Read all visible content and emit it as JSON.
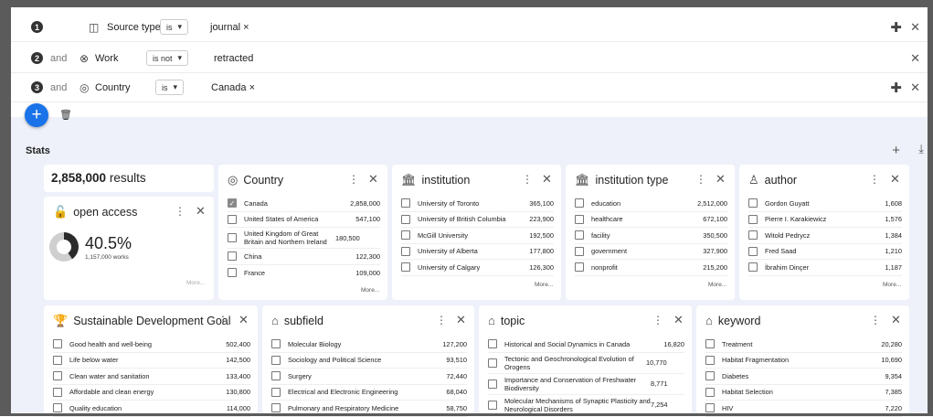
{
  "filters": [
    {
      "num": "1",
      "and": "",
      "icon": "◫",
      "label": "Source type",
      "op": "is",
      "value": "journal ×",
      "plus": true
    },
    {
      "num": "2",
      "and": "and",
      "icon": "⊗",
      "label": "Work",
      "op": "is not",
      "value": "retracted",
      "plus": false
    },
    {
      "num": "3",
      "and": "and",
      "icon": "◎",
      "label": "Country",
      "op": "is",
      "value": "Canada ×",
      "plus": true
    }
  ],
  "stats": {
    "title": "Stats",
    "results_count": "2,858,000",
    "results_label": "results"
  },
  "open_access": {
    "title": "open access",
    "percent": "40.5%",
    "percent_value": 40.5,
    "works": "1,157,000 works",
    "more": "More..."
  },
  "cards": {
    "country": {
      "title": "Country",
      "more": "More...",
      "rows": [
        {
          "label": "Canada",
          "count": "2,858,000",
          "checked": true
        },
        {
          "label": "United States of America",
          "count": "547,100",
          "checked": false
        },
        {
          "label": "United Kingdom of Great Britain and Northern Ireland",
          "count": "180,500",
          "checked": false
        },
        {
          "label": "China",
          "count": "122,300",
          "checked": false
        },
        {
          "label": "France",
          "count": "109,000",
          "checked": false
        }
      ]
    },
    "institution": {
      "title": "institution",
      "more": "More...",
      "rows": [
        {
          "label": "University of Toronto",
          "count": "365,100"
        },
        {
          "label": "University of British Columbia",
          "count": "223,900"
        },
        {
          "label": "McGill University",
          "count": "192,500"
        },
        {
          "label": "University of Alberta",
          "count": "177,800"
        },
        {
          "label": "University of Calgary",
          "count": "126,300"
        }
      ]
    },
    "institution_type": {
      "title": "institution type",
      "more": "More...",
      "rows": [
        {
          "label": "education",
          "count": "2,512,000"
        },
        {
          "label": "healthcare",
          "count": "672,100"
        },
        {
          "label": "facility",
          "count": "350,500"
        },
        {
          "label": "government",
          "count": "327,900"
        },
        {
          "label": "nonprofit",
          "count": "215,200"
        }
      ]
    },
    "author": {
      "title": "author",
      "more": "More...",
      "rows": [
        {
          "label": "Gordon Guyatt",
          "count": "1,608"
        },
        {
          "label": "Pierre I. Karakiewicz",
          "count": "1,576"
        },
        {
          "label": "Witold Pedrycz",
          "count": "1,384"
        },
        {
          "label": "Fred Saad",
          "count": "1,210"
        },
        {
          "label": "İbrahim Dinçer",
          "count": "1,187"
        }
      ]
    },
    "sdg": {
      "title": "Sustainable Development Goal",
      "rows": [
        {
          "label": "Good health and well-being",
          "count": "502,400"
        },
        {
          "label": "Life below water",
          "count": "142,500"
        },
        {
          "label": "Clean water and sanitation",
          "count": "133,400"
        },
        {
          "label": "Affordable and clean energy",
          "count": "130,800"
        },
        {
          "label": "Quality education",
          "count": "114,000"
        }
      ]
    },
    "subfield": {
      "title": "subfield",
      "rows": [
        {
          "label": "Molecular Biology",
          "count": "127,200"
        },
        {
          "label": "Sociology and Political Science",
          "count": "93,510"
        },
        {
          "label": "Surgery",
          "count": "72,440"
        },
        {
          "label": "Electrical and Electronic Engineering",
          "count": "68,040"
        },
        {
          "label": "Pulmonary and Respiratory Medicine",
          "count": "58,750"
        }
      ]
    },
    "topic": {
      "title": "topic",
      "rows": [
        {
          "label": "Historical and Social Dynamics in Canada",
          "count": "16,820"
        },
        {
          "label": "Tectonic and Geochronological Evolution of Orogens",
          "count": "10,770"
        },
        {
          "label": "Importance and Conservation of Freshwater Biodiversity",
          "count": "8,771"
        },
        {
          "label": "Molecular Mechanisms of Synaptic Plasticity and Neurological Disorders",
          "count": "7,254"
        }
      ]
    },
    "keyword": {
      "title": "keyword",
      "rows": [
        {
          "label": "Treatment",
          "count": "20,280"
        },
        {
          "label": "Habitat Fragmentation",
          "count": "10,690"
        },
        {
          "label": "Diabetes",
          "count": "9,354"
        },
        {
          "label": "Habitat Selection",
          "count": "7,385"
        },
        {
          "label": "HIV",
          "count": "7,220"
        }
      ]
    }
  },
  "colors": {
    "accent": "#1a73e8",
    "donut_fill": "#2b2b2b",
    "donut_rest": "#cfcfcf",
    "stats_bg": "#eef1f9"
  }
}
